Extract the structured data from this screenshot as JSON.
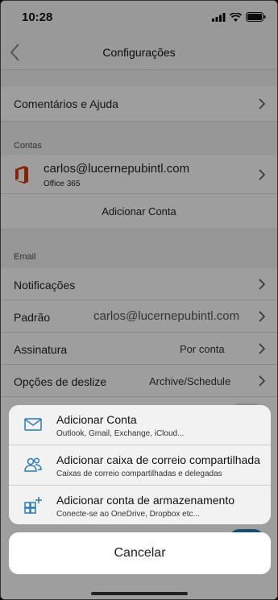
{
  "status_bar": {
    "time": "10:28"
  },
  "nav": {
    "title": "Configurações"
  },
  "settings": {
    "feedback_label": "Comentários e Ajuda",
    "accounts_header": "Contas",
    "account_email": "carlos@lucernepubintl.com",
    "account_type": "Office 365",
    "add_account_label": "Adicionar Conta",
    "email_header": "Email",
    "notifications_label": "Notificações",
    "default_label": "Padrão",
    "default_value": "carlos@lucernepubintl.com",
    "signature_label": "Assinatura",
    "signature_value": "Por conta",
    "swipe_label": "Opções de deslize",
    "swipe_value": "Archive/Schedule"
  },
  "action_sheet": {
    "items": [
      {
        "title": "Adicionar Conta",
        "subtitle": "Outlook, Gmail, Exchange, iCloud...",
        "icon": "mail-icon"
      },
      {
        "title": "Adicionar caixa de correio compartilhada",
        "subtitle": "Caixas de correio compartilhadas e delegadas",
        "icon": "people-icon"
      },
      {
        "title": "Adicionar conta de armazenamento",
        "subtitle": "Conecte-se ao OneDrive, Dropbox etc...",
        "icon": "add-storage-icon"
      }
    ],
    "cancel_label": "Cancelar"
  },
  "colors": {
    "accent": "#2a7ab8",
    "office_red": "#d83b01"
  }
}
